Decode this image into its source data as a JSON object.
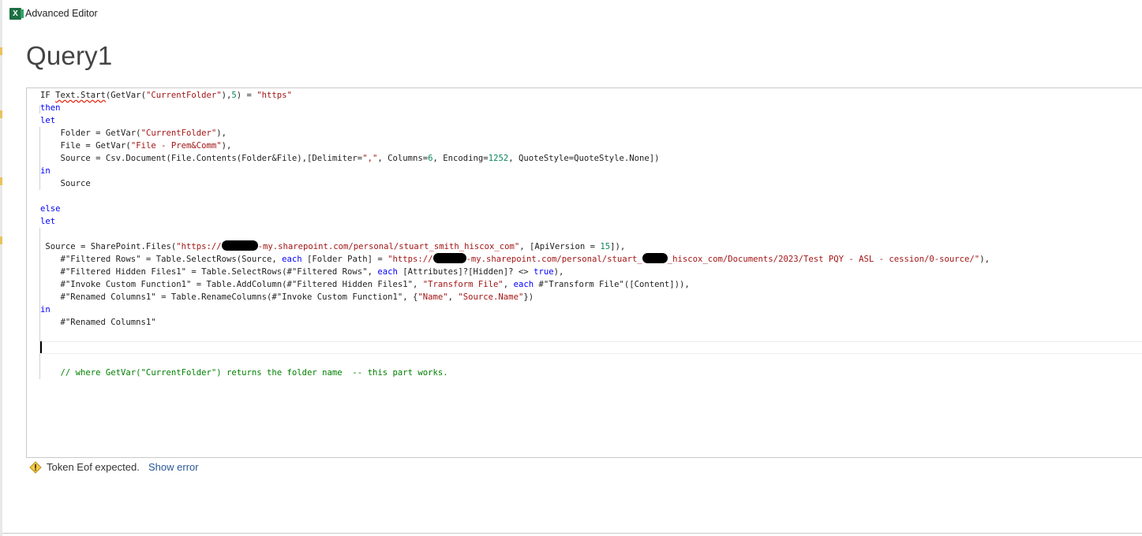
{
  "window": {
    "title": "Advanced Editor",
    "app_icon": "excel-icon",
    "app_icon_letter": "X"
  },
  "query": {
    "name": "Query1"
  },
  "editor": {
    "lines": [
      [
        {
          "t": "IF "
        },
        {
          "t": "Text.Start",
          "c": "squiggle"
        },
        {
          "t": "(GetVar("
        },
        {
          "t": "\"CurrentFolder\"",
          "c": "str"
        },
        {
          "t": "),"
        },
        {
          "t": "5",
          "c": "num"
        },
        {
          "t": ") = "
        },
        {
          "t": "\"https\"",
          "c": "str"
        }
      ],
      [
        {
          "t": "then",
          "c": "kw"
        }
      ],
      [
        {
          "t": "let",
          "c": "kw"
        }
      ],
      [
        {
          "t": "    Folder = GetVar("
        },
        {
          "t": "\"CurrentFolder\"",
          "c": "str"
        },
        {
          "t": "),"
        }
      ],
      [
        {
          "t": "    File = GetVar("
        },
        {
          "t": "\"File - Prem&Comm\"",
          "c": "str"
        },
        {
          "t": "),"
        }
      ],
      [
        {
          "t": "    Source = Csv.Document(File.Contents(Folder&File),[Delimiter="
        },
        {
          "t": "\",\"",
          "c": "str"
        },
        {
          "t": ", Columns="
        },
        {
          "t": "6",
          "c": "num"
        },
        {
          "t": ", Encoding="
        },
        {
          "t": "1252",
          "c": "num"
        },
        {
          "t": ", QuoteStyle=QuoteStyle.None])"
        }
      ],
      [
        {
          "t": "in",
          "c": "kw"
        }
      ],
      [
        {
          "t": "    Source"
        }
      ],
      [],
      [
        {
          "t": "else",
          "c": "kw"
        }
      ],
      [
        {
          "t": "let",
          "c": "kw"
        }
      ],
      [],
      [
        {
          "t": " Source = SharePoint.Files("
        },
        {
          "t": "\"https://",
          "c": "str"
        },
        {
          "r": 46
        },
        {
          "t": "-my.sharepoint.com/personal/stuart_smith_hiscox_com\"",
          "c": "str"
        },
        {
          "t": ", [ApiVersion = "
        },
        {
          "t": "15",
          "c": "num"
        },
        {
          "t": "]),"
        }
      ],
      [
        {
          "t": "    #\"Filtered Rows\" = Table.SelectRows(Source, "
        },
        {
          "t": "each",
          "c": "kw"
        },
        {
          "t": " [Folder Path] = "
        },
        {
          "t": "\"https://",
          "c": "str"
        },
        {
          "r": 42
        },
        {
          "t": "-my.sharepoint.com/personal/stuart_",
          "c": "str"
        },
        {
          "r": 32
        },
        {
          "t": "_hiscox_com/Documents/2023/Test PQY - ASL - cession/0-source/\"",
          "c": "str"
        },
        {
          "t": "),"
        }
      ],
      [
        {
          "t": "    #\"Filtered Hidden Files1\" = Table.SelectRows(#\"Filtered Rows\", "
        },
        {
          "t": "each",
          "c": "kw"
        },
        {
          "t": " [Attributes]?[Hidden]? <> "
        },
        {
          "t": "true",
          "c": "kw"
        },
        {
          "t": "),"
        }
      ],
      [
        {
          "t": "    #\"Invoke Custom Function1\" = Table.AddColumn(#\"Filtered Hidden Files1\", "
        },
        {
          "t": "\"Transform File\"",
          "c": "str"
        },
        {
          "t": ", "
        },
        {
          "t": "each",
          "c": "kw"
        },
        {
          "t": " #\"Transform File\"([Content])),"
        }
      ],
      [
        {
          "t": "    #\"Renamed Columns1\" = Table.RenameColumns(#\"Invoke Custom Function1\", {"
        },
        {
          "t": "\"Name\"",
          "c": "str"
        },
        {
          "t": ", "
        },
        {
          "t": "\"Source.Name\"",
          "c": "str"
        },
        {
          "t": "})"
        }
      ],
      [
        {
          "t": "in",
          "c": "kw"
        }
      ],
      [
        {
          "t": "    #\"Renamed Columns1\""
        }
      ],
      [],
      [],
      [],
      [
        {
          "t": "    // where GetVar(\"CurrentFolder\") returns the folder name  -- this part works.",
          "c": "cmt"
        }
      ]
    ]
  },
  "status": {
    "icon": "warning-icon",
    "message": "Token Eof expected.",
    "link_label": "Show error"
  }
}
